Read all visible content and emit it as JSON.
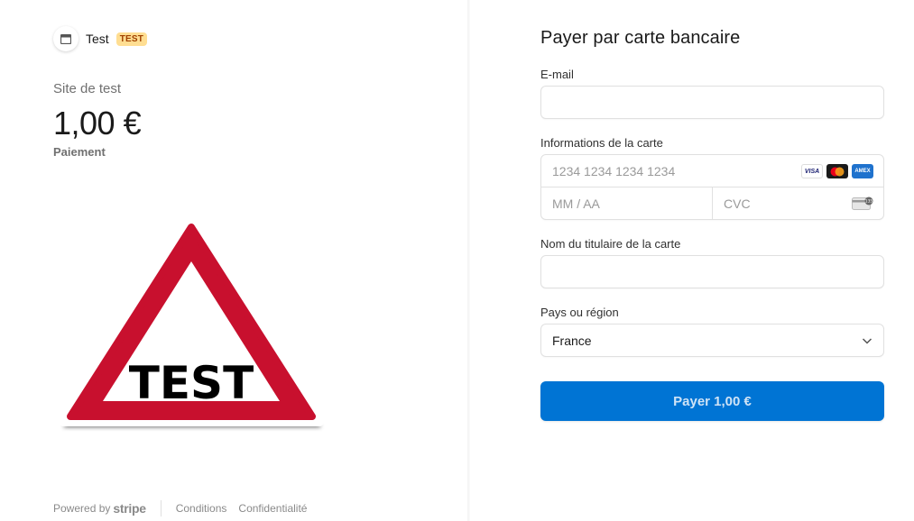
{
  "merchant": {
    "name": "Test",
    "badge": "TEST"
  },
  "product": {
    "name": "Site de test",
    "amount": "1,00 €",
    "amount_subtitle": "Paiement",
    "image_text": "TEST"
  },
  "footer": {
    "powered_by": "Powered by",
    "brand": "stripe",
    "terms": "Conditions",
    "privacy": "Confidentialité"
  },
  "form": {
    "title": "Payer par carte bancaire",
    "email_label": "E-mail",
    "email_value": "",
    "card_label": "Informations de la carte",
    "card_number_placeholder": "1234 1234 1234 1234",
    "expiry_placeholder": "MM / AA",
    "cvc_placeholder": "CVC",
    "card_brands": [
      "VISA",
      "mastercard",
      "AMEX"
    ],
    "cardholder_label": "Nom du titulaire de la carte",
    "cardholder_value": "",
    "country_label": "Pays ou région",
    "country_value": "France",
    "pay_button": "Payer 1,00 €"
  },
  "colors": {
    "accent": "#0074d4",
    "badge_bg": "#ffde92",
    "badge_text": "#a04100",
    "sign_red": "#c8102e"
  }
}
